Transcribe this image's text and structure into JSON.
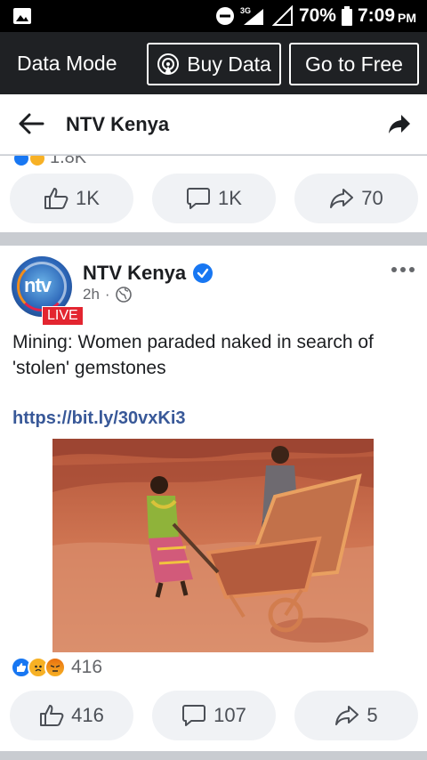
{
  "status_bar": {
    "network": "3G",
    "battery": "70%",
    "time": "7:09",
    "ampm": "PM"
  },
  "data_mode": {
    "label": "Data Mode",
    "buy_label": "Buy Data",
    "free_label": "Go to Free"
  },
  "nav": {
    "title": "NTV Kenya"
  },
  "prev_post": {
    "reaction_count": "1.8K",
    "like_count": "1K",
    "comment_count": "1K",
    "share_count": "70"
  },
  "post": {
    "page_name": "NTV Kenya",
    "live_badge": "LIVE",
    "time": "2h",
    "text": "Mining: Women paraded naked in search of 'stolen' gemstones",
    "link": "https://bit.ly/30vxKi3",
    "reaction_count": "416",
    "like_count": "416",
    "comment_count": "107",
    "share_count": "5"
  },
  "colors": {
    "facebook_blue": "#1877f2",
    "link_blue": "#385898",
    "live_red": "#e32530"
  }
}
